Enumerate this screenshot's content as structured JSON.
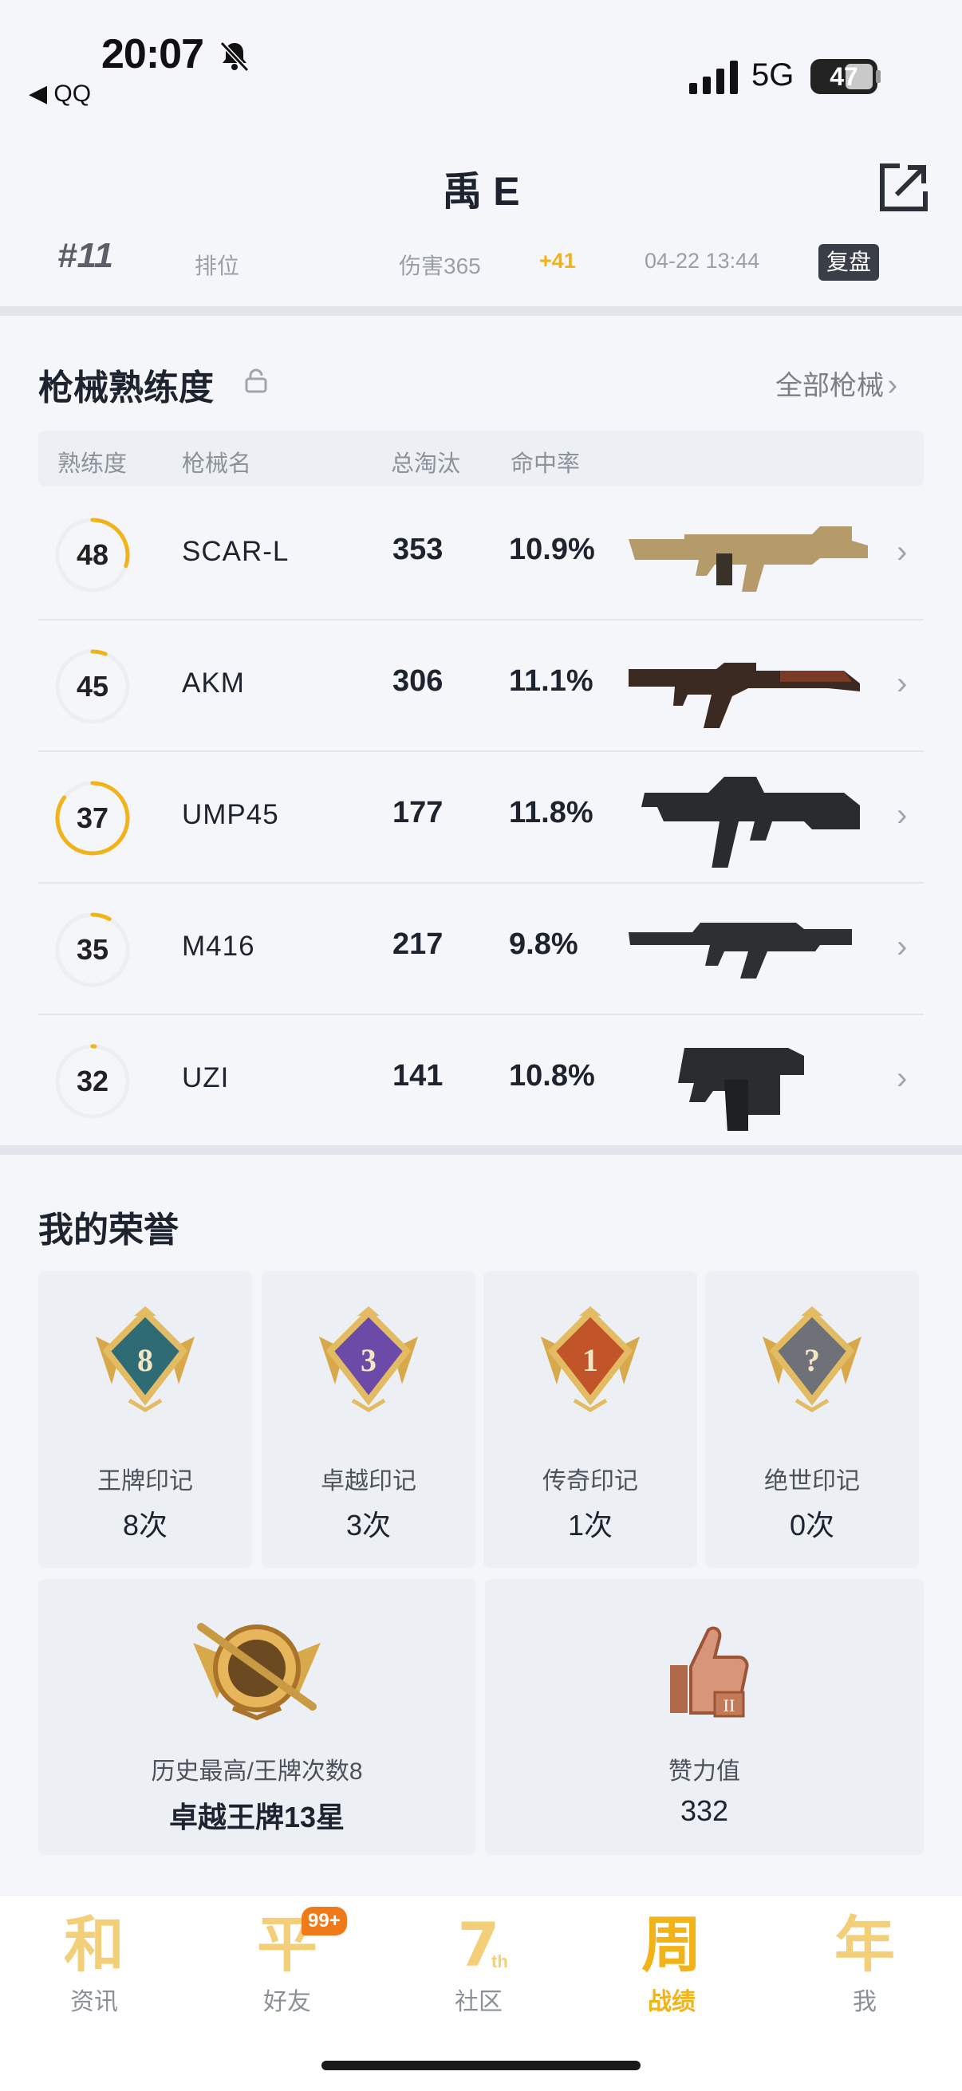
{
  "status": {
    "time": "20:07",
    "back_app": "◀ QQ",
    "network": "5G",
    "battery": "47"
  },
  "header": {
    "title": "禹 E"
  },
  "match": {
    "rank": "#11",
    "mode": "排位",
    "damage": "伤害365",
    "score_change": "+41",
    "datetime": "04-22 13:44",
    "replay": "复盘"
  },
  "weapons": {
    "title": "枪械熟练度",
    "all_link": "全部枪械",
    "columns": [
      "熟练度",
      "枪械名",
      "总淘汰",
      "命中率"
    ],
    "rows": [
      {
        "level": "48",
        "name": "SCAR-L",
        "kills": "353",
        "accuracy": "10.9%",
        "progress": 0.3
      },
      {
        "level": "45",
        "name": "AKM",
        "kills": "306",
        "accuracy": "11.1%",
        "progress": 0.06
      },
      {
        "level": "37",
        "name": "UMP45",
        "kills": "177",
        "accuracy": "11.8%",
        "progress": 0.85
      },
      {
        "level": "35",
        "name": "M416",
        "kills": "217",
        "accuracy": "9.8%",
        "progress": 0.08
      },
      {
        "level": "32",
        "name": "UZI",
        "kills": "141",
        "accuracy": "10.8%",
        "progress": 0.01
      }
    ]
  },
  "honors": {
    "title": "我的荣誉",
    "marks": [
      {
        "name": "王牌印记",
        "count": "8次",
        "badge_text": "8",
        "color": "#2f6b74"
      },
      {
        "name": "卓越印记",
        "count": "3次",
        "badge_text": "3",
        "color": "#6c4aa8"
      },
      {
        "name": "传奇印记",
        "count": "1次",
        "badge_text": "1",
        "color": "#c2542a"
      },
      {
        "name": "绝世印记",
        "count": "0次",
        "badge_text": "?",
        "color": "#6e7278"
      }
    ],
    "best": {
      "label": "历史最高/王牌次数8",
      "value": "卓越王牌13星"
    },
    "likes": {
      "label": "赞力值",
      "value": "332"
    }
  },
  "nav": {
    "items": [
      {
        "label": "资讯",
        "glyph": "和"
      },
      {
        "label": "好友",
        "glyph": "平",
        "badge": "99+"
      },
      {
        "label": "社区",
        "glyph": "7",
        "sup": "th"
      },
      {
        "label": "战绩",
        "glyph": "周"
      },
      {
        "label": "我",
        "glyph": "年"
      }
    ],
    "active": "战绩"
  },
  "colors": {
    "accent": "#f2b318",
    "ring_track": "#eceef1"
  }
}
